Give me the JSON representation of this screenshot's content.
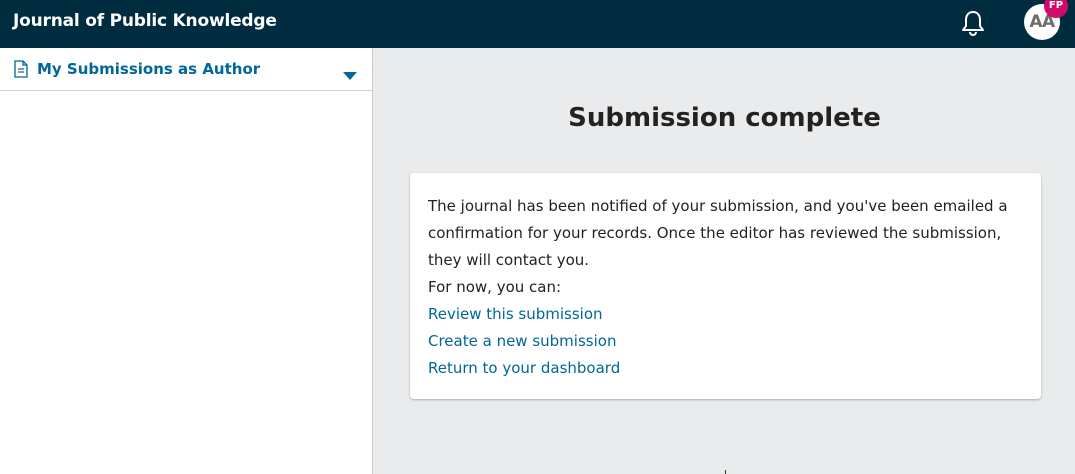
{
  "header": {
    "app_title": "Journal of Public Knowledge",
    "bell_icon": "bell-icon",
    "avatar_initials": "AA",
    "avatar_badge": "FP",
    "badge_color": "#d00a6c",
    "bar_color": "#002c40"
  },
  "sidebar": {
    "section_label": "My Submissions as Author",
    "section_icon": "document-icon",
    "toggle_icon": "chevron-down-icon",
    "accent": "#006798"
  },
  "main": {
    "title": "Submission complete",
    "message_lines": [
      "The journal has been notified of your submission, and you've been emailed a",
      "confirmation for your records. Once the editor has reviewed the submission,",
      "they will contact you."
    ],
    "prompt": "For now, you can:",
    "links": [
      "Review this submission",
      "Create a new submission",
      "Return to your dashboard"
    ]
  }
}
